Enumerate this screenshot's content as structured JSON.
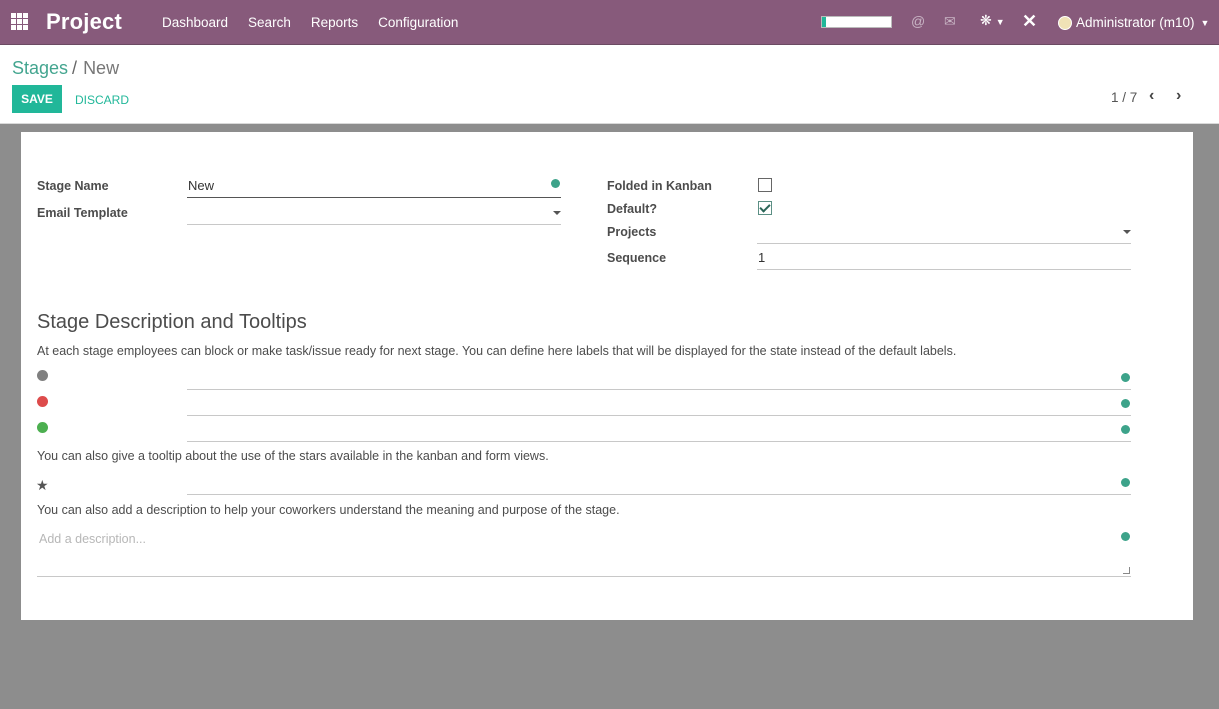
{
  "navbar": {
    "brand": "Project",
    "menu": [
      "Dashboard",
      "Search",
      "Reports",
      "Configuration"
    ],
    "progress": 0.06,
    "user": "Administrator (m10)",
    "icons": [
      "apps-icon",
      "at-icon",
      "chat-icon",
      "bug-icon",
      "close-icon"
    ]
  },
  "breadcrumb": {
    "parent": "Stages",
    "separator": "/",
    "current": "New"
  },
  "buttons": {
    "save": "SAVE",
    "discard": "DISCARD"
  },
  "pager": {
    "value": "1 / 7"
  },
  "form": {
    "left": [
      {
        "label": "Stage Name",
        "value": "New"
      },
      {
        "label": "Email Template",
        "value": ""
      }
    ],
    "right": {
      "folded": {
        "label": "Folded in Kanban",
        "checked": false
      },
      "default": {
        "label": "Default?",
        "checked": true
      },
      "projects": {
        "label": "Projects",
        "value": ""
      },
      "sequence": {
        "label": "Sequence",
        "value": "1"
      }
    }
  },
  "section": {
    "title": "Stage Description and Tooltips",
    "intro": "At each stage employees can block or make task/issue ready for next stage. You can define here labels that will be displayed for the state instead of the default labels.",
    "state_colors": [
      "#808080",
      "#dd4b4b",
      "#4caf50"
    ],
    "stars_text": "You can also give a tooltip about the use of the stars available in the kanban and form views.",
    "desc_text": "You can also add a description to help your coworkers understand the meaning and purpose of the stage.",
    "desc_placeholder": "Add a description..."
  }
}
